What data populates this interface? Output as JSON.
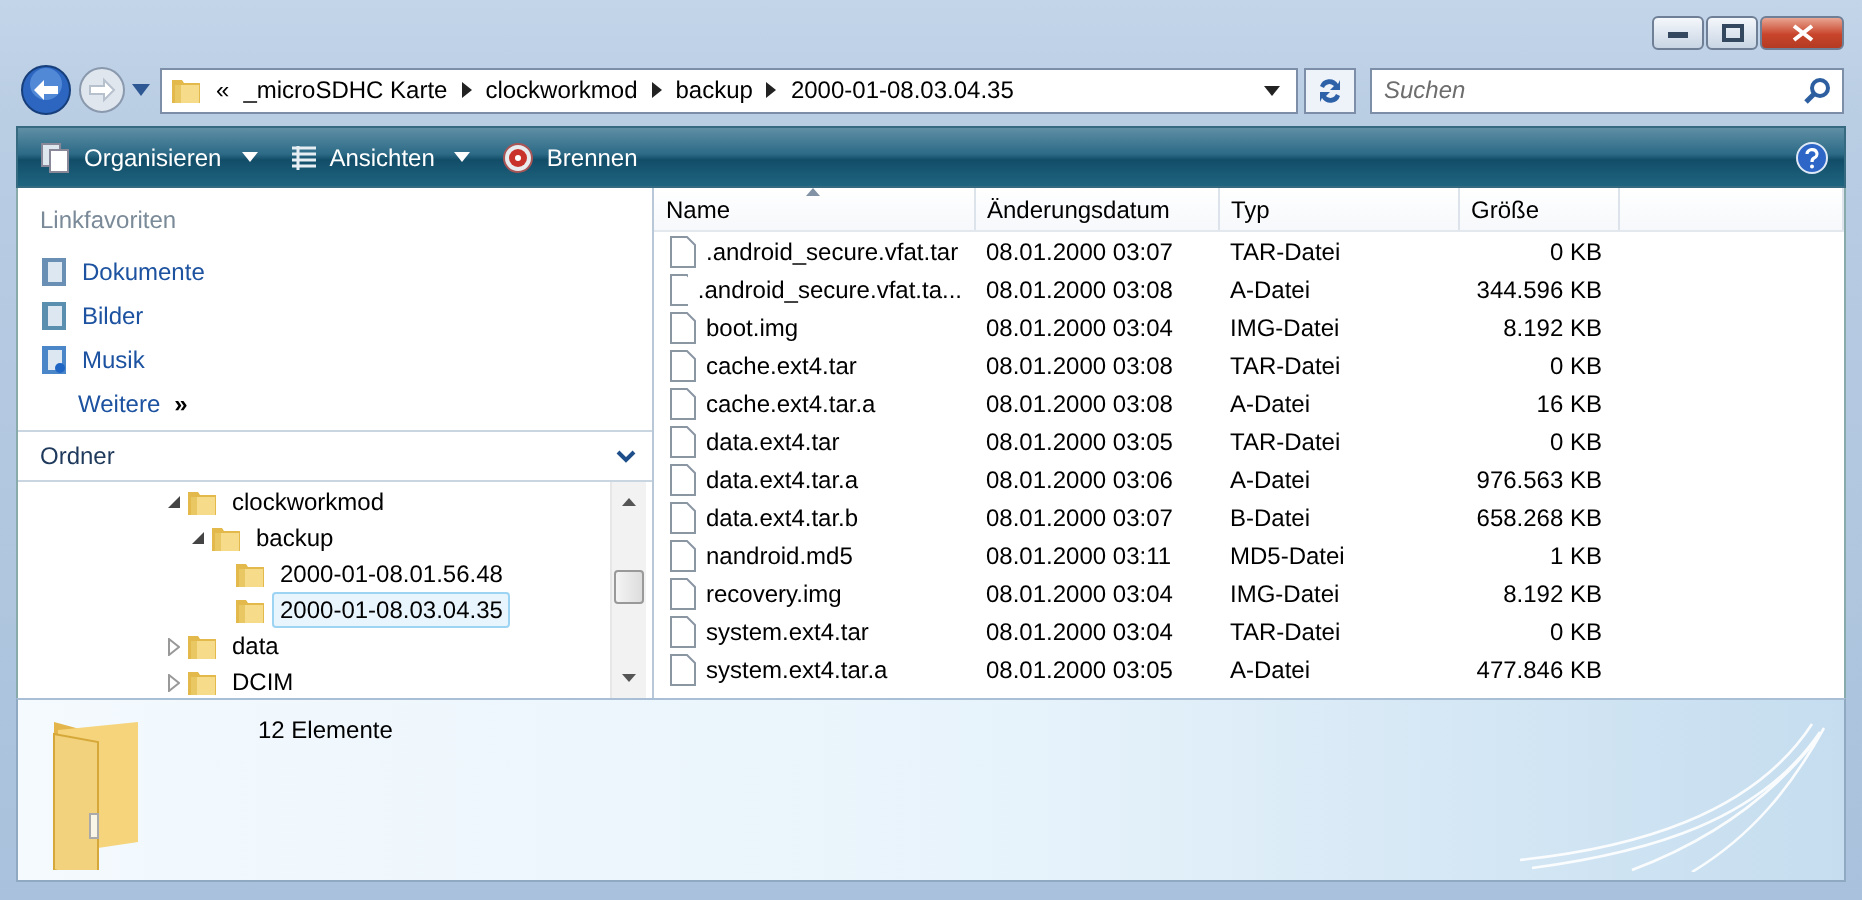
{
  "address": {
    "overflow": "«",
    "crumbs": [
      "_microSDHC Karte",
      "clockworkmod",
      "backup",
      "2000-01-08.03.04.35"
    ]
  },
  "search": {
    "placeholder": "Suchen"
  },
  "toolbar": [
    {
      "label": "Organisieren",
      "kind": "organize"
    },
    {
      "label": "Ansichten",
      "kind": "views"
    },
    {
      "label": "Brennen",
      "kind": "burn"
    }
  ],
  "favorites": {
    "title": "Linkfavoriten",
    "items": [
      {
        "label": "Dokumente",
        "kind": "documents"
      },
      {
        "label": "Bilder",
        "kind": "pictures"
      },
      {
        "label": "Musik",
        "kind": "music"
      }
    ],
    "more": "Weitere",
    "more_mark": "»"
  },
  "folders": {
    "title": "Ordner",
    "tree": [
      {
        "label": "clockworkmod",
        "expanded": true,
        "selected": false,
        "children": [
          {
            "label": "backup",
            "expanded": true,
            "selected": false,
            "children": [
              {
                "label": "2000-01-08.01.56.48",
                "selected": false
              },
              {
                "label": "2000-01-08.03.04.35",
                "selected": true
              }
            ]
          }
        ]
      },
      {
        "label": "data",
        "expanded": false,
        "selected": false
      },
      {
        "label": "DCIM",
        "expanded": false,
        "selected": false
      }
    ]
  },
  "table": {
    "columns": [
      {
        "label": "Name",
        "sorted": true
      },
      {
        "label": "Änderungsdatum",
        "sorted": false
      },
      {
        "label": "Typ",
        "sorted": false
      },
      {
        "label": "Größe",
        "sorted": false
      }
    ],
    "rows": [
      [
        ".android_secure.vfat.tar",
        "08.01.2000 03:07",
        "TAR-Datei",
        "0 KB"
      ],
      [
        ".android_secure.vfat.ta...",
        "08.01.2000 03:08",
        "A-Datei",
        "344.596 KB"
      ],
      [
        "boot.img",
        "08.01.2000 03:04",
        "IMG-Datei",
        "8.192 KB"
      ],
      [
        "cache.ext4.tar",
        "08.01.2000 03:08",
        "TAR-Datei",
        "0 KB"
      ],
      [
        "cache.ext4.tar.a",
        "08.01.2000 03:08",
        "A-Datei",
        "16 KB"
      ],
      [
        "data.ext4.tar",
        "08.01.2000 03:05",
        "TAR-Datei",
        "0 KB"
      ],
      [
        "data.ext4.tar.a",
        "08.01.2000 03:06",
        "A-Datei",
        "976.563 KB"
      ],
      [
        "data.ext4.tar.b",
        "08.01.2000 03:07",
        "B-Datei",
        "658.268 KB"
      ],
      [
        "nandroid.md5",
        "08.01.2000 03:11",
        "MD5-Datei",
        "1 KB"
      ],
      [
        "recovery.img",
        "08.01.2000 03:04",
        "IMG-Datei",
        "8.192 KB"
      ],
      [
        "system.ext4.tar",
        "08.01.2000 03:04",
        "TAR-Datei",
        "0 KB"
      ],
      [
        "system.ext4.tar.a",
        "08.01.2000 03:05",
        "A-Datei",
        "477.846 KB"
      ]
    ]
  },
  "status": {
    "count": "12 Elemente"
  }
}
